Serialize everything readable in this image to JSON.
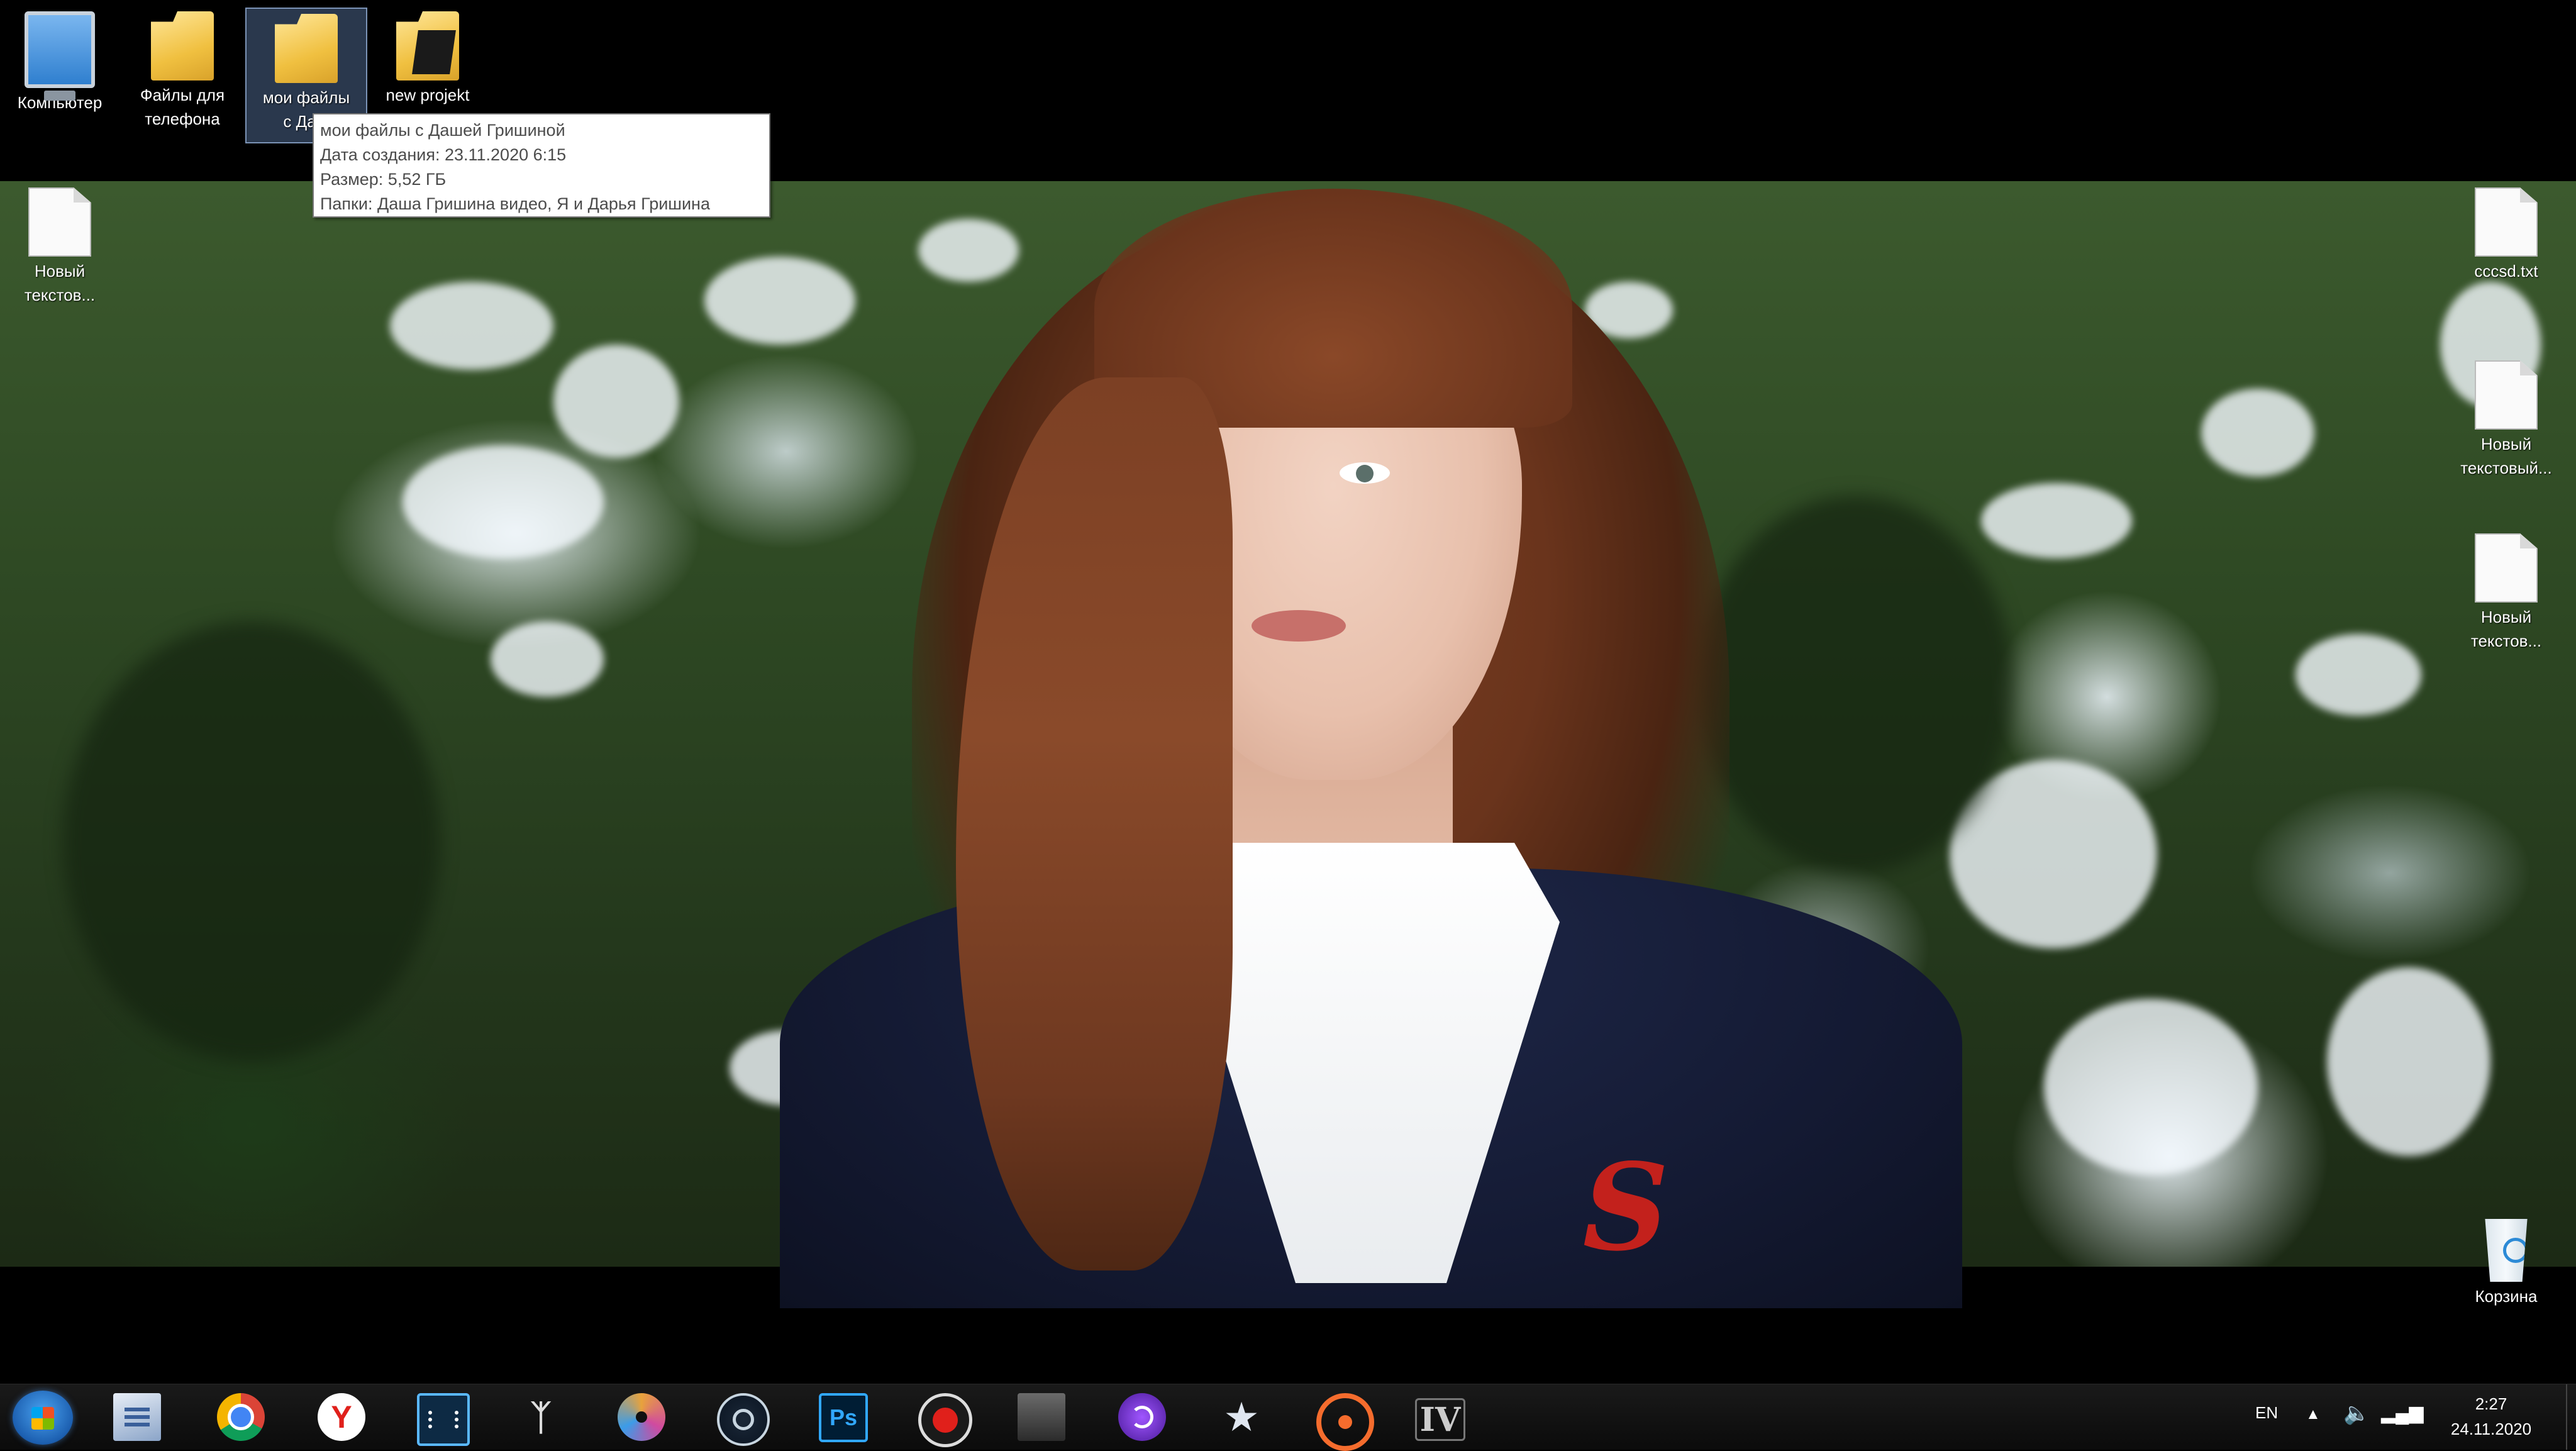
{
  "desktop_icons": [
    {
      "label": "Компьютер",
      "icon": "computer-icon"
    },
    {
      "label": "Файлы для\nтелефона",
      "icon": "folder-icon"
    },
    {
      "label": "мои файлы\nс Даш",
      "icon": "folder-icon",
      "selected": true
    },
    {
      "label": "new projekt",
      "icon": "folder-icon"
    },
    {
      "label": "Новый\nтекстов...",
      "icon": "text-file-icon"
    },
    {
      "label": "cccsd.txt",
      "icon": "text-file-icon"
    },
    {
      "label": "Новый\nтекстовый...",
      "icon": "text-file-icon"
    },
    {
      "label": "Новый\nтекстов...",
      "icon": "text-file-icon"
    },
    {
      "label": "Корзина",
      "icon": "recycle-bin-icon"
    }
  ],
  "tooltip": {
    "line1": "мои файлы с Дашей Гришиной",
    "line2": "Дата создания: 23.11.2020 6:15",
    "line3": "Размер: 5,52 ГБ",
    "line4": "Папки: Даша Гришина видео, Я и Дарья Гришина"
  },
  "wallpaper": {
    "crest_letter": "S"
  },
  "taskbar": {
    "pinned": [
      "start-icon",
      "notepad-icon",
      "chrome-icon",
      "yandex-icon",
      "video-editor-icon",
      "skyrim-icon",
      "media-disc-icon",
      "steam-icon",
      "photoshop-icon",
      "recorder-icon",
      "game-icon",
      "purple-app-icon",
      "star-game-icon",
      "origin-icon",
      "gta-iv-icon"
    ],
    "yandex_letter": "Y",
    "ps_label": "Ps",
    "gta_label": "IV",
    "skyrim_glyph": "ᛉ",
    "star_glyph": "★"
  },
  "tray": {
    "language": "EN",
    "arrow": "▲",
    "volume": "🔈",
    "network": "▂▄▆",
    "time": "2:27",
    "date": "24.11.2020"
  },
  "colors": {
    "taskbar_bg": "#0b0b0b",
    "tooltip_text": "#4c4c4c",
    "crest_red": "#c3211c"
  }
}
